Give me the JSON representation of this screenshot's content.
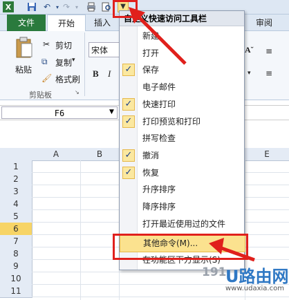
{
  "tabs": {
    "file": "文件",
    "home": "开始",
    "insert": "插入",
    "review": "审阅"
  },
  "ribbon": {
    "paste": "粘贴",
    "cut": "剪切",
    "copy": "复制",
    "format_painter": "格式刷",
    "clipboard_group": "剪贴板",
    "font_name": "宋体",
    "bold": "B",
    "italic": "I"
  },
  "name_box": "F6",
  "columns": [
    "A",
    "B",
    "E"
  ],
  "rows": [
    "1",
    "2",
    "3",
    "4",
    "5",
    "6",
    "7",
    "8",
    "9",
    "10",
    "11"
  ],
  "selected_row": "6",
  "menu": {
    "title": "自定义快速访问工具栏",
    "items": [
      {
        "label": "新建",
        "checked": false
      },
      {
        "label": "打开",
        "checked": false
      },
      {
        "label": "保存",
        "checked": true
      },
      {
        "label": "电子邮件",
        "checked": false
      },
      {
        "label": "快速打印",
        "checked": true
      },
      {
        "label": "打印预览和打印",
        "checked": true
      },
      {
        "label": "拼写检查",
        "checked": false
      },
      {
        "label": "撤消",
        "checked": true
      },
      {
        "label": "恢复",
        "checked": true
      },
      {
        "label": "升序排序",
        "checked": false
      },
      {
        "label": "降序排序",
        "checked": false
      },
      {
        "label": "打开最近使用过的文件",
        "checked": false
      },
      {
        "label": "其他命令(M)...",
        "checked": false,
        "highlighted": true
      },
      {
        "label": "在功能区下方显示(S)",
        "checked": false
      }
    ],
    "check_glyph": "✓"
  },
  "watermark": {
    "brand": "U路由网",
    "number": "191",
    "url": "www.udaxia.com"
  },
  "colors": {
    "annotation_red": "#e0201c",
    "highlight": "#fbe28f",
    "file_tab": "#2a7a3d"
  }
}
